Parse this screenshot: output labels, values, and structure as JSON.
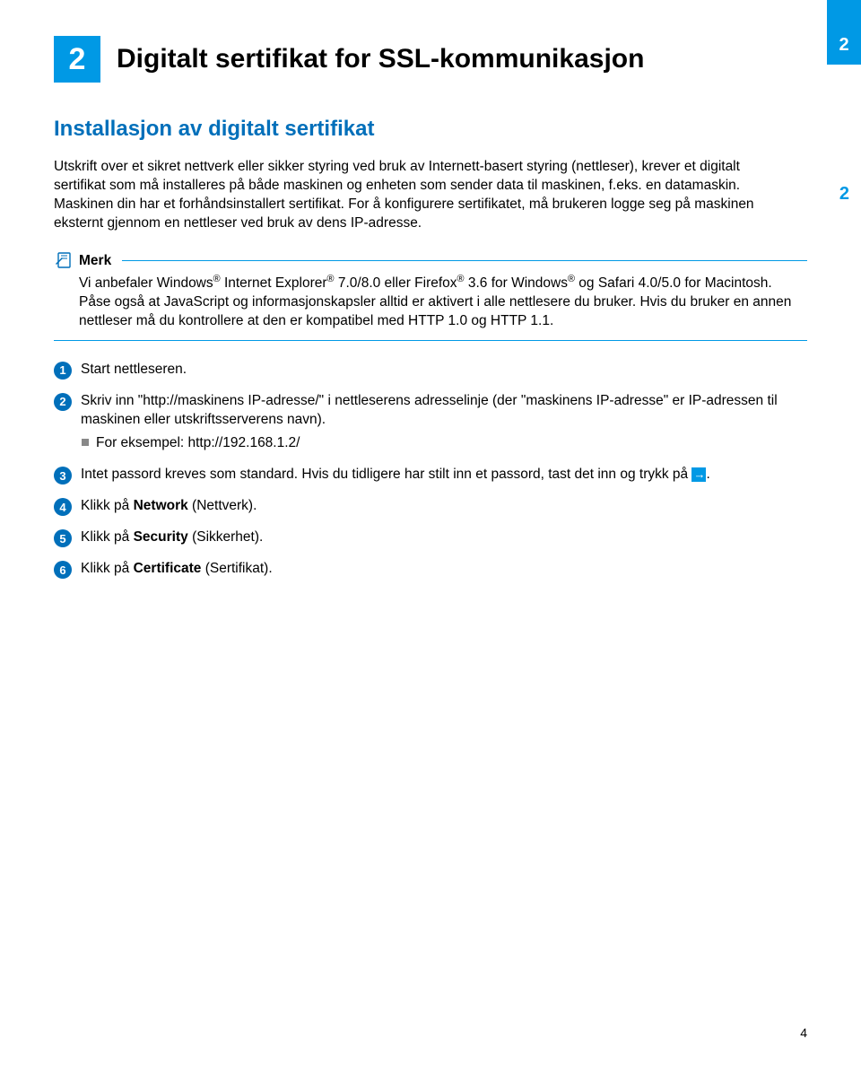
{
  "side_tab": "2",
  "side_label": "2",
  "chapter_number": "2",
  "chapter_title": "Digitalt sertifikat for SSL-kommunikasjon",
  "section_heading": "Installasjon av digitalt sertifikat",
  "intro": "Utskrift over et sikret nettverk eller sikker styring ved bruk av Internett-basert styring (nettleser), krever et digitalt sertifikat som må installeres på både maskinen og enheten som sender data til maskinen, f.eks. en datamaskin. Maskinen din har et forhåndsinstallert sertifikat. For å konfigurere sertifikatet, må brukeren logge seg på maskinen eksternt gjennom en nettleser ved bruk av dens IP-adresse.",
  "note_label": "Merk",
  "note_body_parts": {
    "p1a": "Vi anbefaler Windows",
    "p1b": " Internet Explorer",
    "p1c": " 7.0/8.0 eller Firefox",
    "p1d": " 3.6 for Windows",
    "p1e": " og Safari 4.0/5.0 for Macintosh. Påse også at JavaScript og informasjonskapsler alltid er aktivert i alle nettlesere du bruker. Hvis du bruker en annen nettleser må du kontrollere at den er kompatibel med HTTP 1.0 og HTTP 1.1."
  },
  "steps": [
    {
      "num": "1",
      "text": "Start nettleseren."
    },
    {
      "num": "2",
      "text": "Skriv inn \"http://maskinens IP-adresse/\" i nettleserens adresselinje (der \"maskinens IP-adresse\" er IP-adressen til maskinen eller utskriftsserverens navn).",
      "sub": "For eksempel: http://192.168.1.2/"
    },
    {
      "num": "3",
      "text_a": "Intet passord kreves som standard. Hvis du tidligere har stilt inn et passord, tast det inn og trykk på ",
      "text_b": "."
    },
    {
      "num": "4",
      "text_a": "Klikk på ",
      "bold": "Network",
      "text_b": " (Nettverk)."
    },
    {
      "num": "5",
      "text_a": "Klikk på ",
      "bold": "Security",
      "text_b": " (Sikkerhet)."
    },
    {
      "num": "6",
      "text_a": "Klikk på ",
      "bold": "Certificate",
      "text_b": " (Sertifikat)."
    }
  ],
  "page_number": "4"
}
